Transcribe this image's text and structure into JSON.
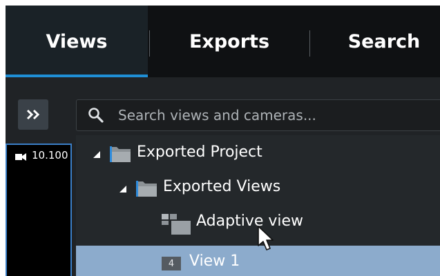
{
  "tabs": [
    {
      "label": "Views",
      "active": true
    },
    {
      "label": "Exports",
      "active": false
    },
    {
      "label": "Search",
      "active": false
    }
  ],
  "search": {
    "placeholder": "Search views and cameras..."
  },
  "camera_tile": {
    "label": "10.100"
  },
  "tree": {
    "items": [
      {
        "label": "Exported Project",
        "icon": "folder-icon",
        "expanded": true
      },
      {
        "label": "Exported Views",
        "icon": "folder-icon",
        "expanded": true
      },
      {
        "label": "Adaptive view",
        "icon": "adaptive-view-icon"
      },
      {
        "label": "View 1",
        "badge": "4",
        "selected": true
      }
    ]
  },
  "colors": {
    "accent": "#1f8fd6",
    "selection": "#8cabcc",
    "tile_border": "#3a7fc8"
  }
}
